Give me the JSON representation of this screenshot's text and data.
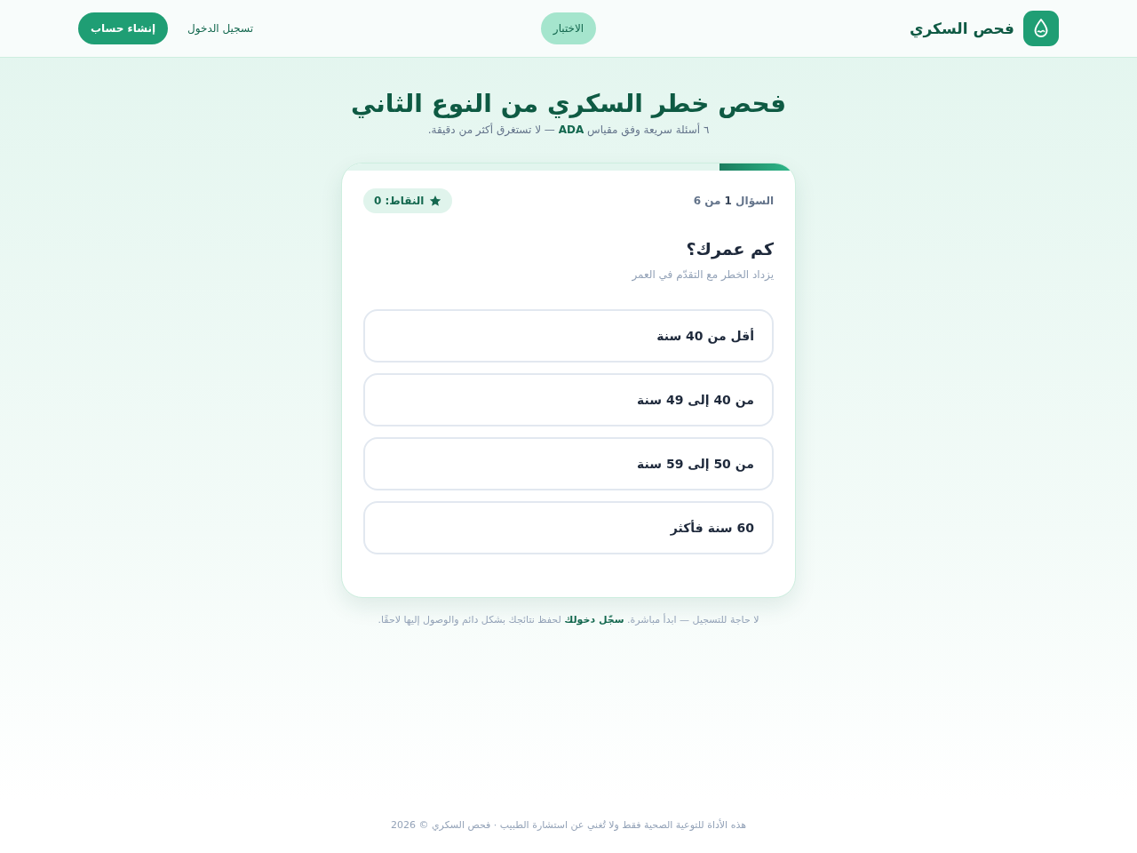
{
  "header": {
    "brand": "فحص السكري",
    "nav": [
      {
        "label": "الاختبار",
        "selected": true
      }
    ],
    "login": "تسجيل الدخول",
    "signup": "إنشاء حساب"
  },
  "hero": {
    "title": "فحص خطر السكري من النوع الثاني",
    "subtitle": "٦ أسئلة سريعة وفق مقياس **ADA** — لا تستغرق أكثر من دقيقة."
  },
  "quiz": {
    "progress": {
      "level": 0.167
    },
    "counter": "السؤال **1** من 6",
    "score": "النقاط: 0",
    "question": "كم عمرك؟",
    "hint": "يزداد الخطر مع التقدّم في العمر",
    "options": [
      {
        "label": "أقل من 40 سنة",
        "selected": false
      },
      {
        "label": "من 40 إلى 49 سنة",
        "selected": false
      },
      {
        "label": "من 50 إلى 59 سنة",
        "selected": false
      },
      {
        "label": "60 سنة فأكثر",
        "selected": false
      }
    ]
  },
  "note": {
    "before": "لا حاجة للتسجيل — ابدأ مباشرة.",
    "link": "سجّل دخولك",
    "after": "لحفظ نتائجك بشكل دائم والوصول إليها لاحقًا."
  },
  "footer": "هذه الأداة للتوعية الصحية فقط ولا تُغني عن استشارة الطبيب · فحص السكري © 2026"
}
